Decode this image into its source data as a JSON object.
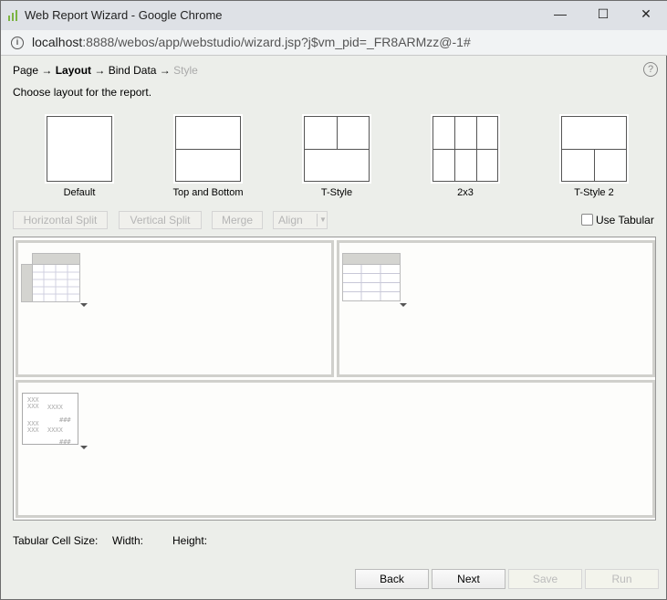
{
  "window": {
    "title": "Web Report Wizard - Google Chrome",
    "minimize": "—",
    "maximize": "☐",
    "close": "✕"
  },
  "address": {
    "host": "localhost",
    "rest": ":8888/webos/app/webstudio/wizard.jsp?j$vm_pid=_FR8ARMzz@-1#"
  },
  "breadcrumb": {
    "steps": [
      "Page",
      "Layout",
      "Bind Data",
      "Style"
    ],
    "arrow": "→",
    "current": "Layout"
  },
  "help": "?",
  "instruction": "Choose layout for the report.",
  "layouts": [
    "Default",
    "Top and Bottom",
    "T-Style",
    "2x3",
    "T-Style 2"
  ],
  "toolbar": {
    "horizontal_split": "Horizontal Split",
    "vertical_split": "Vertical Split",
    "merge": "Merge",
    "align": "Align",
    "use_tabular": "Use Tabular",
    "use_tabular_checked": false
  },
  "cells": [
    {
      "type": "crosstab"
    },
    {
      "type": "table"
    },
    {
      "type": "banded"
    }
  ],
  "banded_icon_text": {
    "a": "XXX",
    "b": "XXXX",
    "c": "###"
  },
  "tabular": {
    "label": "Tabular Cell Size:",
    "width": "Width:",
    "height": "Height:"
  },
  "buttons": {
    "back": "Back",
    "next": "Next",
    "save": "Save",
    "run": "Run"
  }
}
